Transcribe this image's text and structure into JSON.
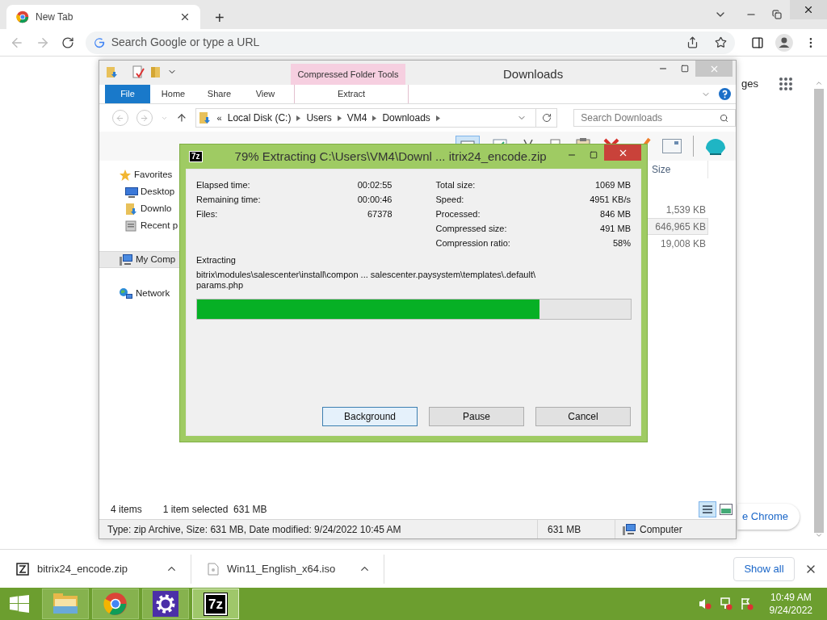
{
  "browser": {
    "tab": {
      "title": "New Tab"
    },
    "new_tab": "+",
    "omnibox": {
      "placeholder": "Search Google or type a URL"
    },
    "page": {
      "partial_link": "ges",
      "partial_button": "e Chrome"
    }
  },
  "explorer": {
    "title": "Downloads",
    "context_tab": "Compressed Folder Tools",
    "ribbon_tabs": [
      {
        "label": "File",
        "kind": "file",
        "selected": false
      },
      {
        "label": "Home",
        "kind": "tab",
        "selected": false
      },
      {
        "label": "Share",
        "kind": "tab",
        "selected": false
      },
      {
        "label": "View",
        "kind": "tab",
        "selected": false
      },
      {
        "label": "Extract",
        "kind": "context",
        "selected": false
      }
    ],
    "breadcrumb": {
      "overflow": "«",
      "parts": [
        "Local Disk (C:)",
        "Users",
        "VM4",
        "Downloads"
      ]
    },
    "search": {
      "placeholder": "Search Downloads"
    },
    "nav": [
      {
        "label": "Favorites",
        "kind": "favorites",
        "selected": false
      },
      {
        "label": "Desktop",
        "kind": "desktop",
        "selected": false
      },
      {
        "label": "Downlo",
        "kind": "downloads",
        "selected": false
      },
      {
        "label": "Recent p",
        "kind": "recent",
        "selected": false
      },
      {
        "label": "My Comp",
        "kind": "computer",
        "selected": true
      },
      {
        "label": "Network",
        "kind": "network",
        "selected": false
      }
    ],
    "columns": [
      {
        "label": "Size"
      }
    ],
    "rows": [
      {
        "size": "1,539 KB",
        "selected": false
      },
      {
        "size": "646,965 KB",
        "selected": true
      },
      {
        "size": "19,008 KB",
        "selected": false
      }
    ],
    "status": {
      "count": "4 items",
      "selection": "1 item selected  631 MB"
    },
    "details": {
      "info": "Type: zip Archive, Size: 631 MB, Date modified: 9/24/2022 10:45 AM",
      "size": "631 MB",
      "location": "Computer"
    }
  },
  "dialog": {
    "icon_text": "7z",
    "title": "79% Extracting C:\\Users\\VM4\\Downl ... itrix24_encode.zip",
    "left_stats": [
      {
        "label": "Elapsed time:",
        "value": "00:02:55"
      },
      {
        "label": "Remaining time:",
        "value": "00:00:46"
      },
      {
        "label": "Files:",
        "value": "67378"
      }
    ],
    "right_stats": [
      {
        "label": "Total size:",
        "value": "1069 MB"
      },
      {
        "label": "Speed:",
        "value": "4951 KB/s"
      },
      {
        "label": "Processed:",
        "value": "846 MB"
      },
      {
        "label": "Compressed size:",
        "value": "491 MB"
      },
      {
        "label": "Compression ratio:",
        "value": "58%"
      }
    ],
    "section_label": "Extracting",
    "current_file": "bitrix\\modules\\salescenter\\install\\compon ... salescenter.paysystem\\templates\\.default\\ params.php",
    "progress": {
      "level": 0.79
    },
    "buttons": [
      {
        "label": "Background",
        "focused": true
      },
      {
        "label": "Pause",
        "focused": false
      },
      {
        "label": "Cancel",
        "focused": false
      }
    ]
  },
  "downloads": {
    "items": [
      {
        "name": "bitrix24_encode.zip",
        "kind": "archive"
      },
      {
        "name": "Win11_English_x64.iso",
        "kind": "disc"
      }
    ],
    "show_all": "Show all"
  },
  "taskbar": {
    "apps": [
      {
        "kind": "explorer",
        "active": false
      },
      {
        "kind": "chrome",
        "active": false
      },
      {
        "kind": "settings",
        "active": false
      },
      {
        "kind": "sevenzip",
        "label": "7z",
        "active": true
      }
    ],
    "time": "10:49 AM",
    "date": "9/24/2022"
  }
}
